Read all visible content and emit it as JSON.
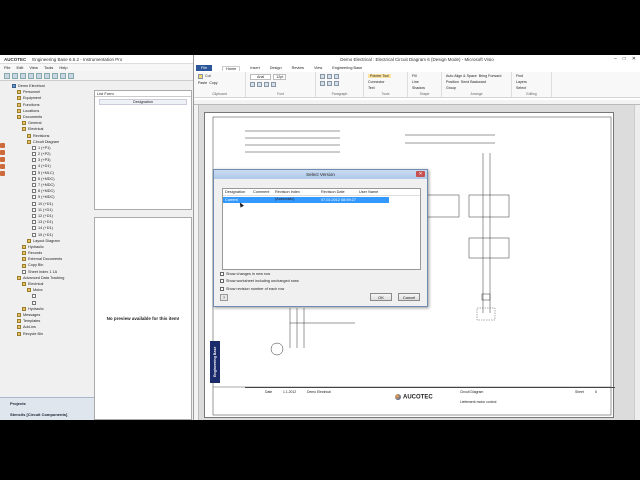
{
  "eb": {
    "title": "Engineering Base 6.5.2 - Instrumentation Pro",
    "logo": "AUCOTEC",
    "menu": [
      "File",
      "Edit",
      "View",
      "Tools",
      "Help"
    ],
    "tree": [
      {
        "label": "Demo Electrical",
        "indent": 0,
        "icon": "blue"
      },
      {
        "label": "Personnel",
        "indent": 1,
        "icon": "folder"
      },
      {
        "label": "Equipment",
        "indent": 1,
        "icon": "folder"
      },
      {
        "label": "Functions",
        "indent": 1,
        "icon": "folder"
      },
      {
        "label": "Locations",
        "indent": 1,
        "icon": "folder"
      },
      {
        "label": "Documents",
        "indent": 1,
        "icon": "folder"
      },
      {
        "label": "General",
        "indent": 2,
        "icon": "folder"
      },
      {
        "label": "Electrical",
        "indent": 2,
        "icon": "folder"
      },
      {
        "label": "Revisions",
        "indent": 3,
        "icon": "folder"
      },
      {
        "label": "Circuit Diagram",
        "indent": 3,
        "icon": "folder"
      },
      {
        "label": "1 (+P1)",
        "indent": 4,
        "icon": "doc"
      },
      {
        "label": "2 (+P2)",
        "indent": 4,
        "icon": "doc"
      },
      {
        "label": "3 (+P3)",
        "indent": 4,
        "icon": "doc"
      },
      {
        "label": "4 (+D1)",
        "indent": 4,
        "icon": "doc"
      },
      {
        "label": "5 (+MLC)",
        "indent": 4,
        "icon": "doc"
      },
      {
        "label": "6 (+MDC)",
        "indent": 4,
        "icon": "doc"
      },
      {
        "label": "7 (+MDC)",
        "indent": 4,
        "icon": "doc"
      },
      {
        "label": "8 (+MDC)",
        "indent": 4,
        "icon": "doc"
      },
      {
        "label": "9 (+MDC)",
        "indent": 4,
        "icon": "doc"
      },
      {
        "label": "10 (+D1)",
        "indent": 4,
        "icon": "doc"
      },
      {
        "label": "11 (+D1)",
        "indent": 4,
        "icon": "doc"
      },
      {
        "label": "12 (+D1)",
        "indent": 4,
        "icon": "doc"
      },
      {
        "label": "13 (+D1)",
        "indent": 4,
        "icon": "doc"
      },
      {
        "label": "14 (+D1)",
        "indent": 4,
        "icon": "doc"
      },
      {
        "label": "15 (+D1)",
        "indent": 4,
        "icon": "doc"
      },
      {
        "label": "Layout Diagram",
        "indent": 3,
        "icon": "folder"
      },
      {
        "label": "Hydraulic",
        "indent": 2,
        "icon": "folder"
      },
      {
        "label": "Records",
        "indent": 2,
        "icon": "folder"
      },
      {
        "label": "External Documents",
        "indent": 2,
        "icon": "folder"
      },
      {
        "label": "Copy Bin",
        "indent": 2,
        "icon": "folder"
      },
      {
        "label": "Sheet Index 1 1A",
        "indent": 2,
        "icon": "doc"
      },
      {
        "label": "Advanced Data Tracking",
        "indent": 1,
        "icon": "folder"
      },
      {
        "label": "Electrical",
        "indent": 2,
        "icon": "folder"
      },
      {
        "label": "Motor",
        "indent": 3,
        "icon": "folder"
      },
      {
        "label": "",
        "indent": 4,
        "icon": "doc"
      },
      {
        "label": "",
        "indent": 4,
        "icon": "doc"
      },
      {
        "label": "Hydraulic",
        "indent": 2,
        "icon": "folder"
      },
      {
        "label": "Messages",
        "indent": 1,
        "icon": "folder"
      },
      {
        "label": "Templates",
        "indent": 1,
        "icon": "folder"
      },
      {
        "label": "Add-ins",
        "indent": 1,
        "icon": "folder"
      },
      {
        "label": "Recycle Bin",
        "indent": 1,
        "icon": "folder"
      }
    ],
    "bottom_tabs": [
      "Projects",
      "Stencils [Circuit Components]"
    ],
    "listform_label": "List Form",
    "listform_column": "Designation",
    "preview_text": "No preview available for this item!"
  },
  "visio": {
    "title": "Demo Electrical : Electrical Circuit Diagram 6 (Design Mode) - Microsoft Visio",
    "tabs": [
      "File",
      "Home",
      "Insert",
      "Design",
      "Review",
      "View",
      "Engineering Base"
    ],
    "active_tab": "Home",
    "ribbon_groups": [
      "Clipboard",
      "Font",
      "Paragraph",
      "Tools",
      "Shape",
      "Arrange",
      "Editing"
    ],
    "ribbon_items": {
      "paste": "Paste",
      "cut": "Cut",
      "copy": "Copy",
      "format_painter": "Format Painter",
      "font": "Arial",
      "size": "12pt",
      "pointer": "Pointer Tool",
      "connector": "Connector",
      "text": "Text",
      "fill": "Fill",
      "line": "Line",
      "shadow": "Shadow",
      "auto_align": "Auto Align & Space",
      "position": "Position",
      "bring_forward": "Bring Forward",
      "send_backward": "Send Backward",
      "group": "Group",
      "find": "Find",
      "layers": "Layers",
      "select": "Select"
    },
    "eng_label": "Engineering Base",
    "title_block": {
      "company": "AUCOTEC",
      "project": "Demo Electrical",
      "doc": "Circuit Diagram",
      "sub": "Lieferwerk motor control",
      "date_label": "Date",
      "date": "1.1.2012",
      "sheet_label": "Sheet",
      "sheet": "6"
    }
  },
  "dialog": {
    "title": "Select Version",
    "columns": [
      "Designation",
      "Comment",
      "Revision Index (Automatic)",
      "Revision Date",
      "User Name"
    ],
    "rows": [
      {
        "designation": "Current Version",
        "comment": "",
        "revision_index": "",
        "revision_date": "07.02.2012 08:59:27",
        "user": "",
        "selected": true
      }
    ],
    "checkboxes": [
      "Show changes in new row",
      "Show worksheet including unchanged rows",
      "Show revision number of each row"
    ],
    "help_label": "?",
    "ok_label": "OK",
    "cancel_label": "Cancel"
  }
}
